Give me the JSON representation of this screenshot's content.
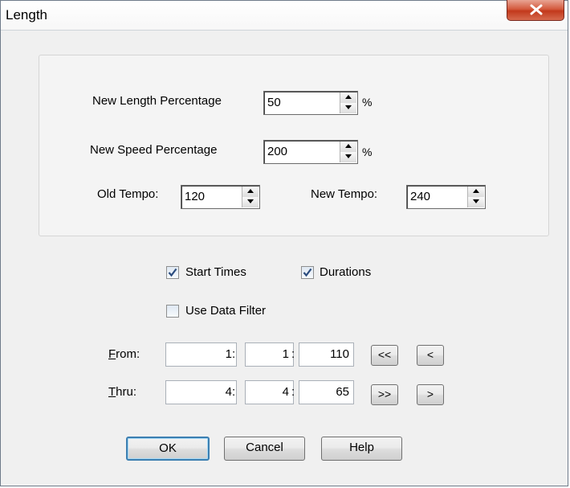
{
  "window": {
    "title": "Length"
  },
  "icons": {
    "close": "close-x-icon",
    "spin_up": "triangle-up-icon",
    "spin_down": "triangle-down-icon",
    "check": "checkmark-icon"
  },
  "colors": {
    "close_button": "#c7432a",
    "default_button_border": "#3c7fb1",
    "checkbox_check": "#2b4c7e"
  },
  "length_pct": {
    "label": "New Length Percentage",
    "value": "50",
    "unit": "%"
  },
  "speed_pct": {
    "label": "New Speed Percentage",
    "value": "200",
    "unit": "%"
  },
  "old_tempo": {
    "label": "Old Tempo:",
    "value": "120"
  },
  "new_tempo": {
    "label": "New Tempo:",
    "value": "240"
  },
  "options": {
    "start_times": {
      "label": "Start Times",
      "checked": true
    },
    "durations": {
      "label": "Durations",
      "checked": true
    },
    "use_data_filter": {
      "label": "Use Data Filter",
      "checked": false
    }
  },
  "from": {
    "mnemonic": "F",
    "label_rest": "rom:",
    "measure": "1",
    "beat": "1",
    "tick": "110",
    "separator": ":",
    "first_btn": "<<",
    "prev_btn": "<"
  },
  "thru": {
    "mnemonic": "T",
    "label_rest": "hru:",
    "measure": "4",
    "beat": "4",
    "tick": "65",
    "separator": ":",
    "last_btn": ">>",
    "next_btn": ">"
  },
  "buttons": {
    "ok": "OK",
    "cancel": "Cancel",
    "help": "Help"
  }
}
